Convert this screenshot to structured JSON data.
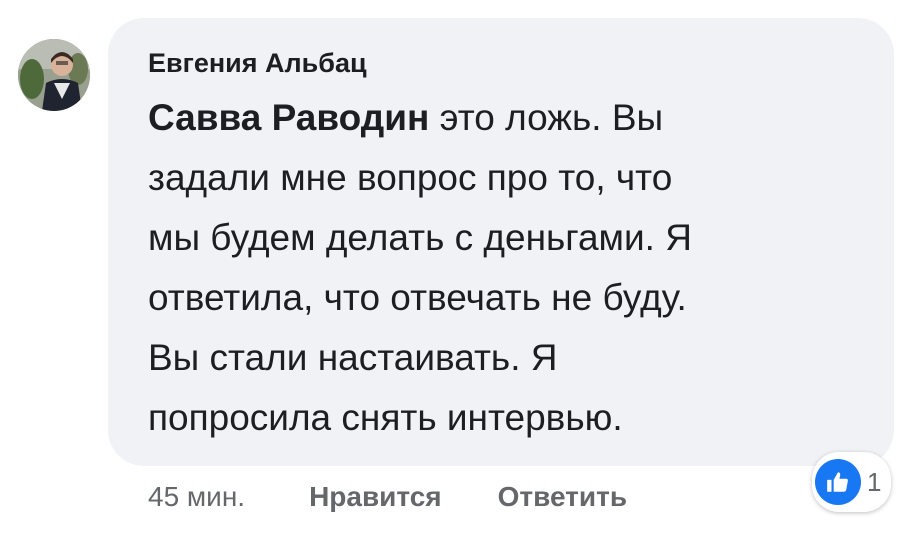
{
  "comment": {
    "author": "Евгения Альбац",
    "mention": "Савва Раводин",
    "text_lines": [
      " это ложь. Вы",
      "задали мне вопрос про то, что",
      "мы будем делать с деньгами. Я",
      "ответила, что отвечать не буду.",
      "Вы стали настаивать. Я",
      "попросила снять интервью."
    ],
    "time": "45 мин.",
    "like_label": "Нравится",
    "reply_label": "Ответить",
    "reaction_icon": "thumbs-up-icon",
    "reaction_count": "1"
  },
  "colors": {
    "bubble_bg": "#f0f2f5",
    "text": "#1c1e21",
    "meta": "#65676b",
    "like_blue": "#1877f2"
  }
}
